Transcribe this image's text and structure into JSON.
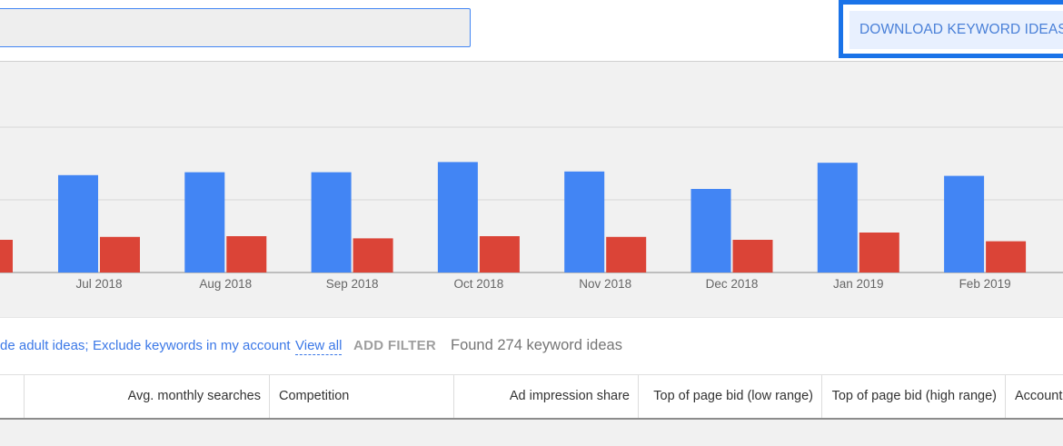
{
  "toolbar": {
    "search_value": "",
    "download_label": "DOWNLOAD KEYWORD IDEAS"
  },
  "colors": {
    "accent": "#4285f4",
    "series_blue": "#4285f4",
    "series_red": "#db4437",
    "highlight_border": "#1a73e8"
  },
  "chart_data": {
    "type": "bar",
    "categories": [
      "Jul 2018",
      "Aug 2018",
      "Sep 2018",
      "Oct 2018",
      "Nov 2018",
      "Dec 2018",
      "Jan 2019",
      "Feb 2019"
    ],
    "series": [
      {
        "values": [
          134,
          138,
          138,
          152,
          139,
          115,
          151,
          133
        ],
        "color": "#4285f4"
      },
      {
        "values": [
          49,
          50,
          47,
          50,
          49,
          45,
          55,
          43
        ],
        "color": "#db4437"
      }
    ],
    "partial_red_left": 45,
    "ylim": [
      0,
      200
    ],
    "grid": true
  },
  "filters": {
    "exclude_adult": "de adult ideas;",
    "exclude_account": "Exclude keywords in my account",
    "view_all": "View all",
    "add_filter": "ADD FILTER",
    "found": "Found 274 keyword ideas"
  },
  "table": {
    "headers": [
      "Avg. monthly searches",
      "Competition",
      "Ad impression share",
      "Top of page bid (low range)",
      "Top of page bid (high range)",
      "Account"
    ]
  }
}
